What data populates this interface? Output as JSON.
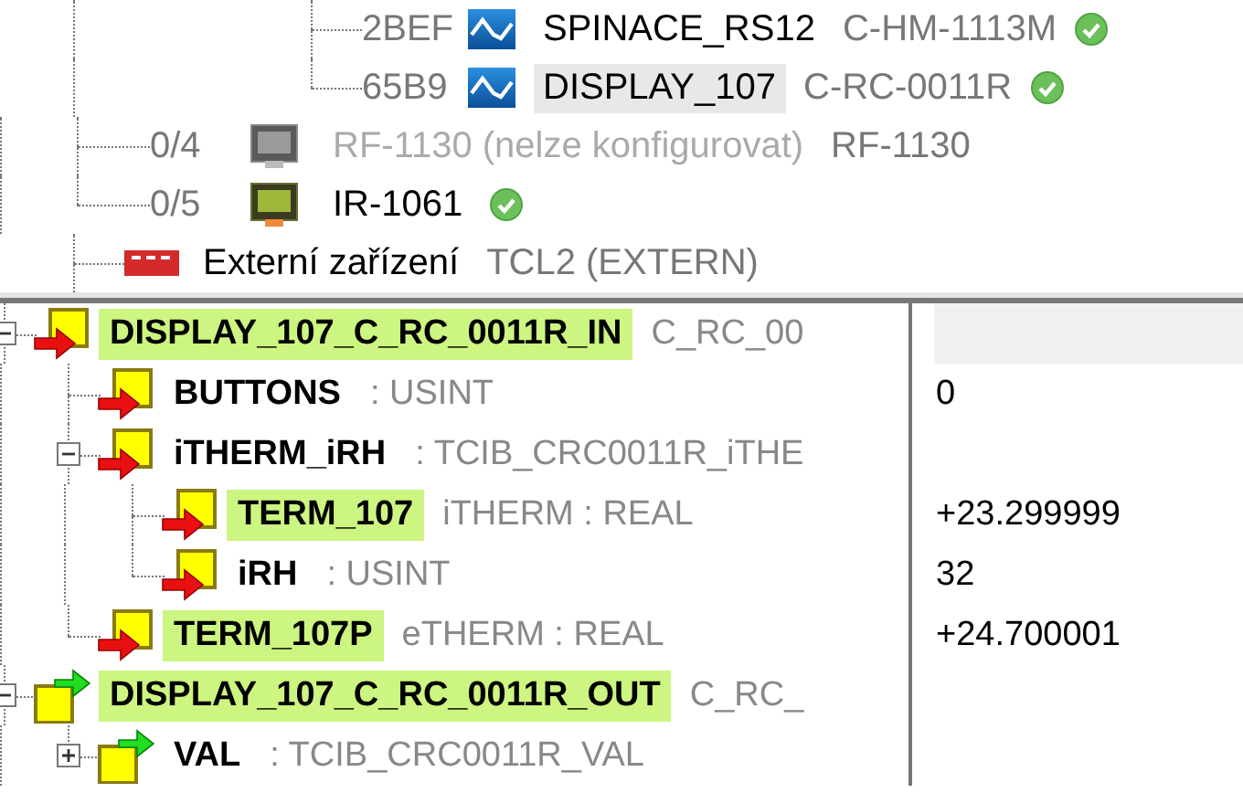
{
  "device_tree": {
    "modules": [
      {
        "address": "2BEF",
        "name": "SPINACE_RS12",
        "type": "C-HM-1113M",
        "ok": true,
        "selected": false
      },
      {
        "address": "65B9",
        "name": "DISPLAY_107",
        "type": "C-RC-0011R",
        "ok": true,
        "selected": true
      }
    ],
    "bus_devices": [
      {
        "address": "0/4",
        "name": "RF-1130 (nelze konfigurovat)",
        "type": "RF-1130",
        "disabled": true,
        "ok": false
      },
      {
        "address": "0/5",
        "name": "IR-1061",
        "disabled": false,
        "ok": true
      }
    ],
    "external": {
      "name": "Externí zařízení",
      "type": "TCL2 (EXTERN)"
    }
  },
  "variables": {
    "items": [
      {
        "kind": "input",
        "name": "DISPLAY_107_C_RC_0011R_IN",
        "type": "C_RC_00",
        "highlighted": true,
        "expanded": true,
        "children": [
          {
            "kind": "input",
            "name": "BUTTONS",
            "type": ": USINT",
            "value": "0",
            "highlighted": false
          },
          {
            "kind": "input",
            "name": "iTHERM_iRH",
            "type": ": TCIB_CRC0011R_iTHE",
            "highlighted": false,
            "expanded": true,
            "children": [
              {
                "kind": "input",
                "name": "TERM_107",
                "type": "iTHERM : REAL",
                "value": "+23.299999",
                "highlighted": true
              },
              {
                "kind": "input",
                "name": "iRH",
                "type": ": USINT",
                "value": "32",
                "highlighted": false
              }
            ]
          },
          {
            "kind": "input",
            "name": "TERM_107P",
            "type": "eTHERM : REAL",
            "value": "+24.700001",
            "highlighted": true
          }
        ]
      },
      {
        "kind": "output",
        "name": "DISPLAY_107_C_RC_0011R_OUT",
        "type": "C_RC_",
        "highlighted": true,
        "expanded": true,
        "children": [
          {
            "kind": "output",
            "name": "VAL",
            "type": ": TCIB_CRC0011R_VAL",
            "highlighted": false,
            "expanded": false
          }
        ]
      }
    ]
  }
}
